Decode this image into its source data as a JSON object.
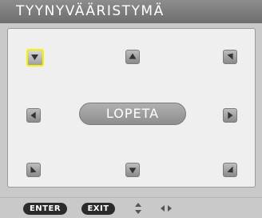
{
  "title": "TYYNYVÄÄRISTYMÄ",
  "lopeta_label": "LOPETA",
  "arrows": [
    {
      "name": "top-left-adjust-button",
      "icon": "triangle-down-right-icon",
      "selected": true
    },
    {
      "name": "top-center-adjust-button",
      "icon": "triangle-up-icon",
      "selected": false
    },
    {
      "name": "top-right-adjust-button",
      "icon": "triangle-down-left-icon",
      "selected": false
    },
    {
      "name": "middle-left-adjust-button",
      "icon": "triangle-left-icon",
      "selected": false
    },
    {
      "name": "middle-right-adjust-button",
      "icon": "triangle-right-icon",
      "selected": false
    },
    {
      "name": "bottom-left-adjust-button",
      "icon": "triangle-up-right-icon",
      "selected": false
    },
    {
      "name": "bottom-center-adjust-button",
      "icon": "triangle-down-icon",
      "selected": false
    },
    {
      "name": "bottom-right-adjust-button",
      "icon": "triangle-up-left-icon",
      "selected": false
    }
  ],
  "footer": {
    "enter_label": "ENTER",
    "exit_label": "EXIT",
    "updown_icon": "up-down-arrows-icon",
    "leftright_icon": "left-right-arrows-icon"
  },
  "colors": {
    "selection": "#f3f500",
    "titlebar": "#7a7a7a",
    "panel": "#efefef"
  }
}
